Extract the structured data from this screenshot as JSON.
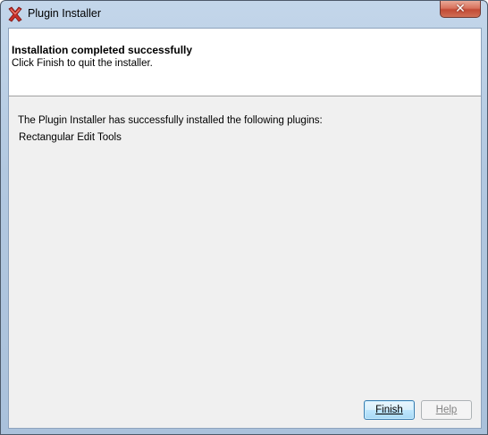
{
  "window": {
    "title": "Plugin Installer",
    "icon": "plugin-installer-x-icon",
    "close_glyph": "✕"
  },
  "header": {
    "title": "Installation completed successfully",
    "subtitle": "Click Finish to quit the installer."
  },
  "body": {
    "message": "The Plugin Installer has successfully installed the following plugins:",
    "plugins": [
      "Rectangular Edit Tools"
    ]
  },
  "buttons": {
    "finish_label": "Finish",
    "help_label": "Help"
  },
  "colors": {
    "icon_red": "#c8302a",
    "close_button": "#c24a35",
    "finish_border": "#3c7fb1"
  }
}
